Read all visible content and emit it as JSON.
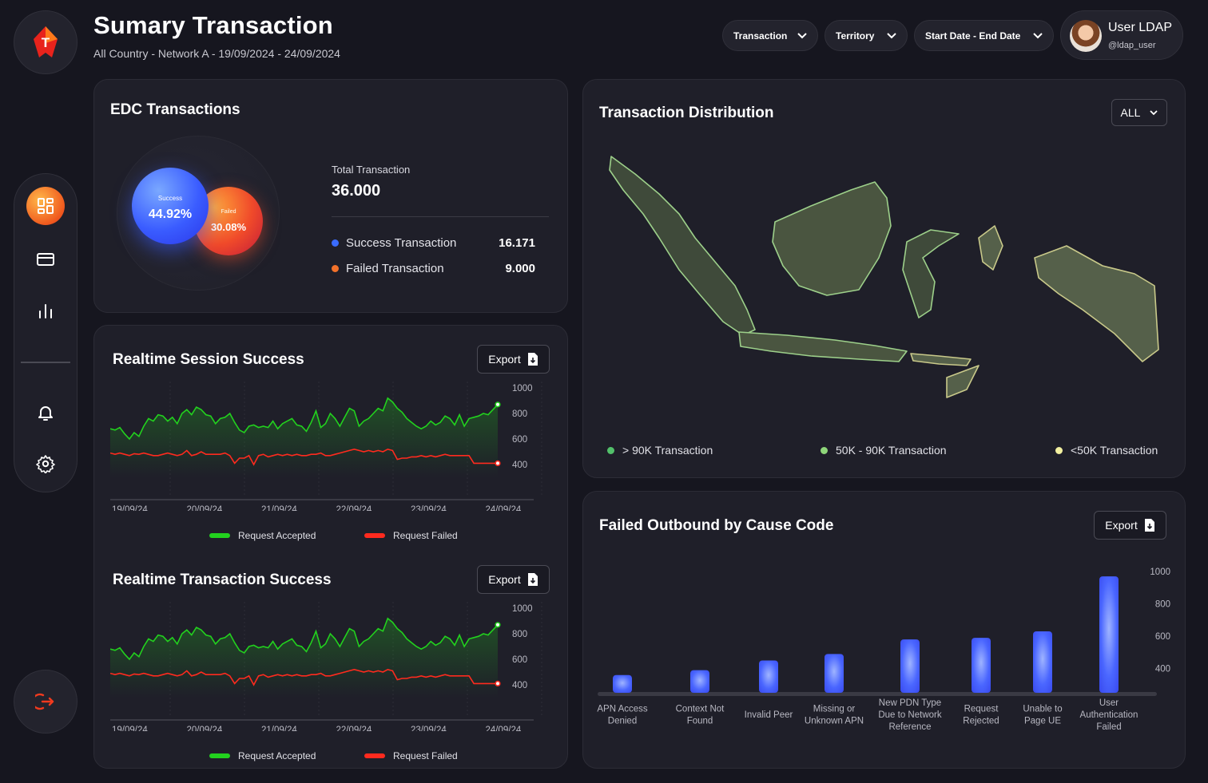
{
  "brand": {
    "logo_letter": "T",
    "accent": "#f05a1e",
    "logo_color": "#e8231c"
  },
  "header": {
    "title": "Sumary Transaction",
    "subtitle": "All Country - Network A - 19/09/2024 - 24/09/2024",
    "filters": [
      "Transaction",
      "Territory",
      "Start Date - End Date"
    ]
  },
  "user": {
    "name": "User LDAP",
    "handle": "@ldap_user"
  },
  "sidebar": {
    "items": [
      "dashboard-icon",
      "card-icon",
      "bar-chart-icon",
      "bell-icon",
      "gear-icon"
    ],
    "logout": "logout-icon"
  },
  "edc": {
    "title": "EDC Transactions",
    "success_label": "Success",
    "success_pct": "44.92%",
    "failed_label": "Failed",
    "failed_pct": "30.08%",
    "total_label": "Total Transaction",
    "total_value": "36.000",
    "rows": [
      {
        "label": "Success Transaction",
        "value": "16.171",
        "color": "#3a6cff"
      },
      {
        "label": "Failed Transaction",
        "value": "9.000",
        "color": "#f2712a"
      }
    ]
  },
  "distribution": {
    "title": "Transaction Distribution",
    "filter": "ALL",
    "legend": [
      {
        "label": "> 90K Transaction",
        "color": "#52c06a"
      },
      {
        "label": "50K - 90K Transaction",
        "color": "#8fd67a"
      },
      {
        "label": "<50K Transaction",
        "color": "#f2f0a0"
      }
    ]
  },
  "session": {
    "title": "Realtime Session Success",
    "export_label": "Export",
    "legend_accepted": "Request Accepted",
    "legend_failed": "Request Failed",
    "x_labels": [
      "19/09/24",
      "20/09/24",
      "21/09/24",
      "22/09/24",
      "23/09/24",
      "24/09/24"
    ],
    "y_labels": [
      "1000",
      "800",
      "600",
      "400"
    ]
  },
  "transaction": {
    "title": "Realtime Transaction Success",
    "export_label": "Export",
    "legend_accepted": "Request Accepted",
    "legend_failed": "Request Failed",
    "x_labels": [
      "19/09/24",
      "20/09/24",
      "21/09/24",
      "22/09/24",
      "23/09/24",
      "24/09/24"
    ],
    "y_labels": [
      "1000",
      "800",
      "600",
      "400"
    ]
  },
  "failed_outbound": {
    "title": "Failed Outbound by Cause Code",
    "export_label": "Export",
    "y_labels": [
      "1000",
      "800",
      "600",
      "400"
    ]
  },
  "chart_data": [
    {
      "type": "line",
      "title": "Realtime Session Success",
      "x": [
        "19/09/24",
        "20/09/24",
        "21/09/24",
        "22/09/24",
        "23/09/24",
        "24/09/24"
      ],
      "ylim": [
        300,
        1000
      ],
      "series": [
        {
          "name": "Request Accepted",
          "color": "#22d11e",
          "values": [
            680,
            670,
            690,
            640,
            600,
            650,
            620,
            700,
            760,
            740,
            790,
            780,
            740,
            770,
            720,
            800,
            830,
            790,
            850,
            830,
            790,
            780,
            720,
            760,
            770,
            800,
            730,
            670,
            650,
            700,
            710,
            690,
            700,
            690,
            740,
            680,
            720,
            740,
            760,
            710,
            700,
            660,
            730,
            820,
            690,
            720,
            800,
            760,
            700,
            770,
            840,
            820,
            700,
            740,
            760,
            800,
            840,
            820,
            920,
            890,
            840,
            810,
            760,
            730,
            700,
            680,
            700,
            740,
            710,
            730,
            780,
            760,
            710,
            790,
            700,
            760,
            770,
            780,
            800,
            790,
            830,
            870
          ]
        },
        {
          "name": "Request Failed",
          "color": "#ff2a1e",
          "values": [
            490,
            480,
            490,
            480,
            470,
            485,
            480,
            490,
            480,
            470,
            470,
            480,
            490,
            480,
            470,
            480,
            510,
            470,
            480,
            500,
            480,
            480,
            480,
            480,
            490,
            470,
            410,
            450,
            450,
            470,
            400,
            470,
            480,
            460,
            470,
            480,
            470,
            480,
            470,
            480,
            470,
            470,
            480,
            480,
            490,
            470,
            470,
            480,
            490,
            500,
            510,
            520,
            510,
            500,
            510,
            500,
            510,
            500,
            520,
            510,
            440,
            450,
            450,
            460,
            460,
            470,
            460,
            470,
            460,
            470,
            480,
            470,
            470,
            470,
            470,
            470,
            410,
            410,
            410,
            410,
            410,
            410
          ]
        }
      ]
    },
    {
      "type": "line",
      "title": "Realtime Transaction Success",
      "x": [
        "19/09/24",
        "20/09/24",
        "21/09/24",
        "22/09/24",
        "23/09/24",
        "24/09/24"
      ],
      "ylim": [
        300,
        1000
      ],
      "series": [
        {
          "name": "Request Accepted",
          "color": "#22d11e",
          "values": [
            680,
            670,
            690,
            640,
            600,
            650,
            620,
            700,
            760,
            740,
            790,
            780,
            740,
            770,
            720,
            800,
            830,
            790,
            850,
            830,
            790,
            780,
            720,
            760,
            770,
            800,
            730,
            670,
            650,
            700,
            710,
            690,
            700,
            690,
            740,
            680,
            720,
            740,
            760,
            710,
            700,
            660,
            730,
            820,
            690,
            720,
            800,
            760,
            700,
            770,
            840,
            820,
            700,
            740,
            760,
            800,
            840,
            820,
            920,
            890,
            840,
            810,
            760,
            730,
            700,
            680,
            700,
            740,
            710,
            730,
            780,
            760,
            710,
            790,
            700,
            760,
            770,
            780,
            800,
            790,
            830,
            870
          ]
        },
        {
          "name": "Request Failed",
          "color": "#ff2a1e",
          "values": [
            490,
            480,
            490,
            480,
            470,
            485,
            480,
            490,
            480,
            470,
            470,
            480,
            490,
            480,
            470,
            480,
            510,
            470,
            480,
            500,
            480,
            480,
            480,
            480,
            490,
            470,
            410,
            450,
            450,
            470,
            400,
            470,
            480,
            460,
            470,
            480,
            470,
            480,
            470,
            480,
            470,
            470,
            480,
            480,
            490,
            470,
            470,
            480,
            490,
            500,
            510,
            520,
            510,
            500,
            510,
            500,
            510,
            500,
            520,
            510,
            440,
            450,
            450,
            460,
            460,
            470,
            460,
            470,
            460,
            470,
            480,
            470,
            470,
            470,
            470,
            470,
            410,
            410,
            410,
            410,
            410,
            410
          ]
        }
      ]
    },
    {
      "type": "bar",
      "title": "Failed Outbound by Cause Code",
      "categories": [
        "APN Access Denied",
        "Context Not Found",
        "Invalid Peer",
        "Missing or Unknown APN",
        "New PDN Type Due to Network Reference",
        "Request Rejected",
        "Unable to Page UE",
        "User Authentication Failed"
      ],
      "values": [
        360,
        390,
        450,
        490,
        580,
        590,
        630,
        970
      ],
      "ylim": [
        250,
        1000
      ],
      "color": "#3a5cff"
    }
  ]
}
